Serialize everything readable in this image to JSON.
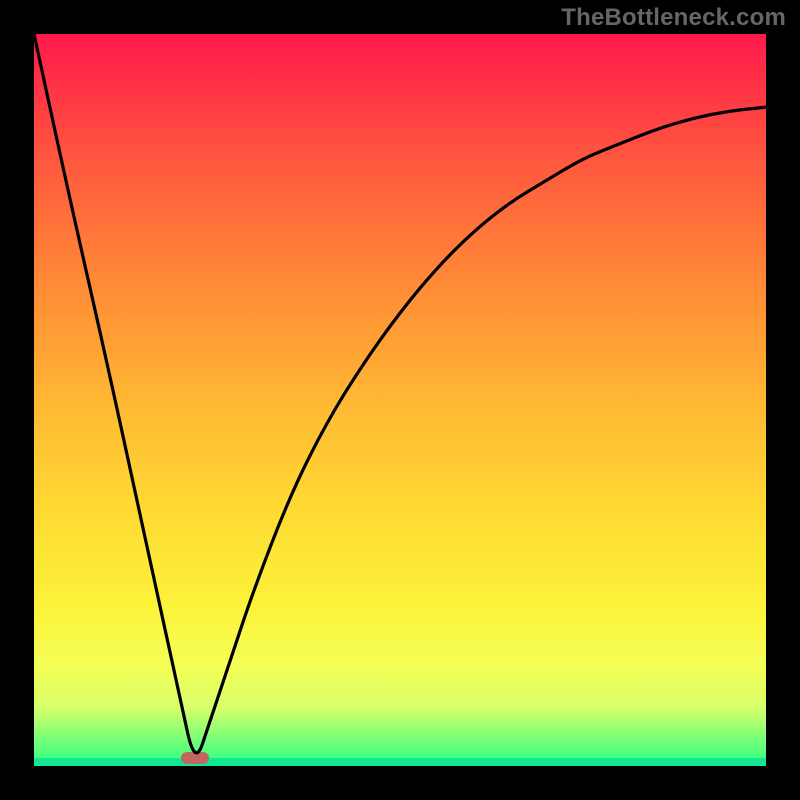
{
  "watermark": "TheBottleneck.com",
  "colors": {
    "page_bg": "#000000",
    "curve": "#000000",
    "marker": "#C06860",
    "gradient_stops": [
      "#ff1a4b",
      "#ff2f47",
      "#ff5a3e",
      "#ff8a36",
      "#ffb733",
      "#ffdc33",
      "#fbf23a",
      "#f5ff55",
      "#d8ff6a",
      "#7fff77",
      "#2bff84"
    ]
  },
  "chart_data": {
    "type": "line",
    "title": "",
    "xlabel": "",
    "ylabel": "",
    "xlim": [
      0,
      1
    ],
    "ylim": [
      0,
      1
    ],
    "notes": "V-shaped bottleneck curve. Minimum (marker) near x≈0.22. Left arm rises to 1 at x=0; right arm rises asymptotically toward ~0.9 as x→1. Background maps y=1 (top) to red → y=0 (bottom) to green.",
    "marker_x": 0.22,
    "series": [
      {
        "name": "bottleneck-curve",
        "x": [
          0.0,
          0.05,
          0.1,
          0.15,
          0.2,
          0.22,
          0.24,
          0.27,
          0.3,
          0.35,
          0.4,
          0.45,
          0.5,
          0.55,
          0.6,
          0.65,
          0.7,
          0.75,
          0.8,
          0.85,
          0.9,
          0.95,
          1.0
        ],
        "values": [
          1.0,
          0.77,
          0.55,
          0.32,
          0.09,
          0.0,
          0.06,
          0.15,
          0.24,
          0.37,
          0.47,
          0.55,
          0.62,
          0.68,
          0.73,
          0.77,
          0.8,
          0.83,
          0.85,
          0.87,
          0.885,
          0.895,
          0.9
        ]
      }
    ]
  }
}
